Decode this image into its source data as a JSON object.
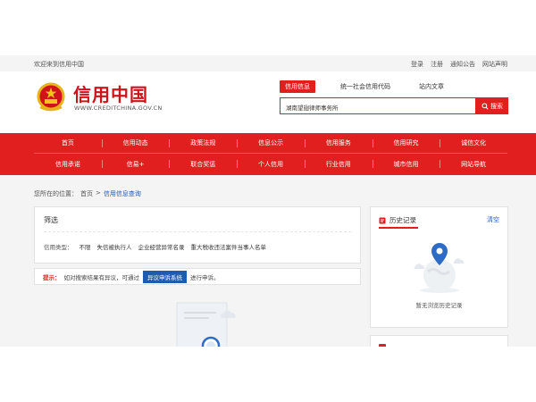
{
  "topbar": {
    "welcome": "欢迎来到信用中国",
    "links": [
      "登录",
      "注册",
      "通知公告",
      "网站声明"
    ]
  },
  "logo": {
    "name_cn": "信用中国",
    "url_en": "WWW.CREDITCHINA.GOV.CN"
  },
  "search": {
    "tabs": [
      "信用信息",
      "统一社会信用代码",
      "站内文章"
    ],
    "active_tab": "信用信息",
    "query": "湖南望翅律师事务所",
    "button_label": "搜索"
  },
  "nav": {
    "row1": [
      "首页",
      "信用动态",
      "政策法规",
      "信息公示",
      "信用服务",
      "信用研究",
      "诚信文化"
    ],
    "row2": [
      "信用承诺",
      "信易+",
      "联合奖惩",
      "个人信用",
      "行业信用",
      "城市信用",
      "网站导航"
    ]
  },
  "breadcrumb": {
    "prefix": "您所在的位置：",
    "home": "首页",
    "sep": ">",
    "current": "信用信息查询"
  },
  "filter": {
    "title": "筛选",
    "type_label": "信用类型：",
    "options": [
      "不限",
      "失信被执行人",
      "企业经营异常名录",
      "重大税收违法案件当事人名单"
    ]
  },
  "notice": {
    "key": "提示：",
    "text_before": "如对搜索结果有异议，可通过",
    "appeal_button": "异议申诉系统",
    "text_after": "进行申诉。"
  },
  "history": {
    "title": "历史记录",
    "clear": "清空",
    "empty_text": "暂无浏览历史记录"
  },
  "colors": {
    "brand_red": "#e21f1f",
    "link_blue": "#1e5cb3"
  }
}
